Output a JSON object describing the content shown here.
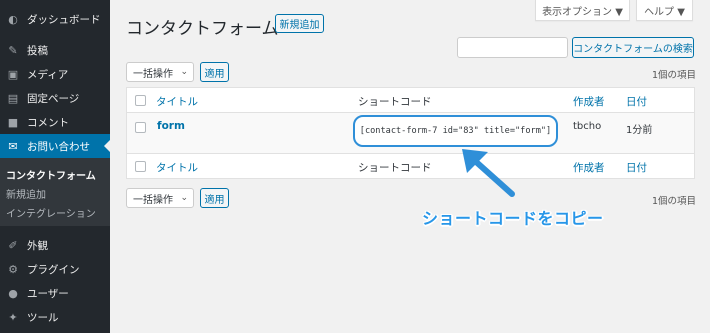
{
  "sidebar": {
    "items": [
      {
        "label": "ダッシュボード",
        "icon": "dashboard-icon"
      },
      {
        "label": "投稿",
        "icon": "pin-icon"
      },
      {
        "label": "メディア",
        "icon": "media-icon"
      },
      {
        "label": "固定ページ",
        "icon": "page-icon"
      },
      {
        "label": "コメント",
        "icon": "comment-icon"
      },
      {
        "label": "お問い合わせ",
        "icon": "mail-icon"
      },
      {
        "label": "外観",
        "icon": "appearance-icon"
      },
      {
        "label": "プラグイン",
        "icon": "plugin-icon"
      },
      {
        "label": "ユーザー",
        "icon": "user-icon"
      },
      {
        "label": "ツール",
        "icon": "wrench-icon"
      }
    ],
    "submenu": [
      "コンタクトフォーム",
      "新規追加",
      "インテグレーション"
    ]
  },
  "header": {
    "title": "コンタクトフォーム",
    "add_new": "新規追加",
    "screen_options": "表示オプション ▼",
    "help": "ヘルプ ▼"
  },
  "search": {
    "button": "コンタクトフォームの検索",
    "value": ""
  },
  "bulk": {
    "label": "一括操作",
    "apply": "適用"
  },
  "count_text": "1個の項目",
  "table": {
    "columns": [
      "タイトル",
      "ショートコード",
      "作成者",
      "日付"
    ],
    "rows": [
      {
        "title": "form",
        "shortcode": "[contact-form-7 id=\"83\" title=\"form\"]",
        "author": "tbcho",
        "date": "1分前"
      }
    ]
  },
  "callout": "ショートコードをコピー",
  "colors": {
    "sidebar": "#23282d",
    "accent": "#0073aa",
    "annotation": "#2f8fd8"
  }
}
